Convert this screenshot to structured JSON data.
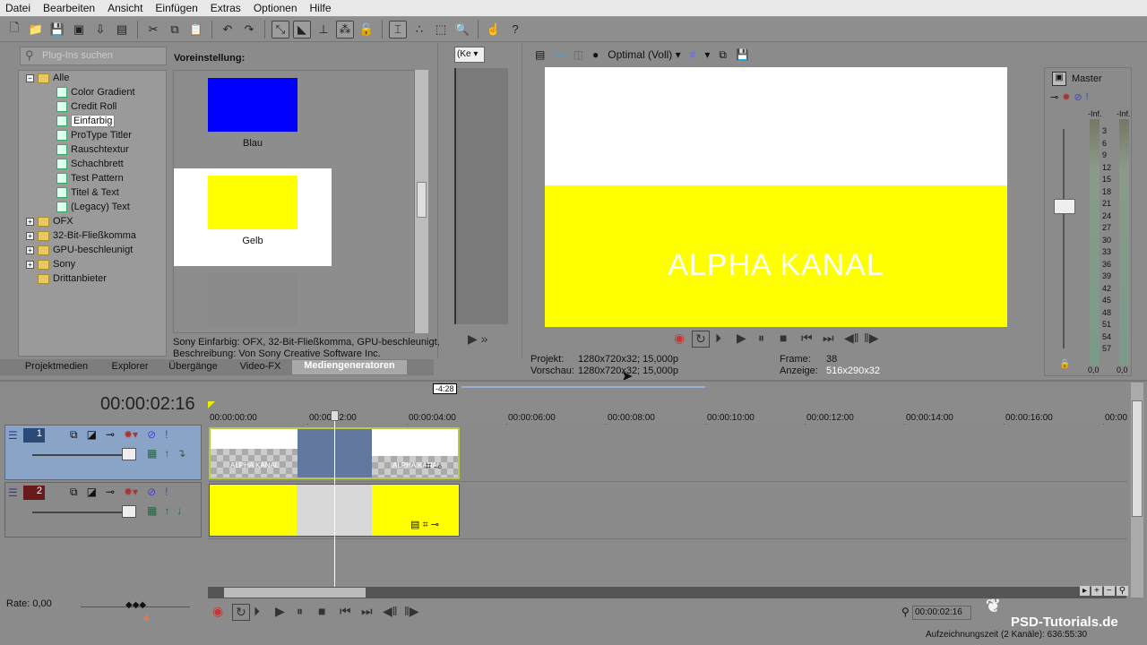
{
  "menu": [
    "Datei",
    "Bearbeiten",
    "Ansicht",
    "Einfügen",
    "Extras",
    "Optionen",
    "Hilfe"
  ],
  "plugin_search": {
    "placeholder": "Plug-Ins suchen"
  },
  "tree": {
    "root": "Alle",
    "children": [
      "Color Gradient",
      "Credit Roll",
      "Einfarbig",
      "ProType Titler",
      "Rauschtextur",
      "Schachbrett",
      "Test Pattern",
      "Titel & Text",
      "(Legacy) Text"
    ],
    "selected": "Einfarbig",
    "folders": [
      "OFX",
      "32-Bit-Fließkomma",
      "GPU-beschleunigt",
      "Sony",
      "Drittanbieter"
    ]
  },
  "presets": {
    "header": "Voreinstellung:",
    "items": [
      {
        "label": "Blau",
        "color": "#0000ff"
      },
      {
        "label": "Gelb",
        "color": "#ffff00"
      },
      {
        "label": "",
        "color": "#8a8a8a"
      }
    ]
  },
  "description": {
    "line1": "Sony Einfarbig: OFX, 32-Bit-Fließkomma, GPU-beschleunigt,",
    "line2": "Beschreibung: Von Sony Creative Software Inc."
  },
  "tabs": [
    "Projektmedien",
    "Explorer",
    "Übergänge",
    "Video-FX",
    "Mediengeneratoren"
  ],
  "trimmer": {
    "dropdown": "(Ke"
  },
  "preview": {
    "quality": "Optimal (Voll)",
    "overlay_text": "ALPHA KANAL",
    "projekt_label": "Projekt:",
    "projekt": "1280x720x32; 15,000p",
    "vorschau_label": "Vorschau:",
    "vorschau": "1280x720x32; 15,000p",
    "frame_label": "Frame:",
    "frame": "38",
    "anzeige_label": "Anzeige:",
    "anzeige": "516x290x32"
  },
  "mixer": {
    "title": "Master",
    "left_peak": "-Inf.",
    "right_peak": "-Inf.",
    "left_val": "0,0",
    "right_val": "0,0",
    "scale": [
      "3",
      "6",
      "9",
      "12",
      "15",
      "18",
      "21",
      "24",
      "27",
      "30",
      "33",
      "36",
      "39",
      "42",
      "45",
      "48",
      "51",
      "54",
      "57"
    ]
  },
  "timeline": {
    "timecode": "00:00:02:16",
    "loop_region": "-4:28",
    "ruler": [
      "00:00:00:00",
      "00:00:02:00",
      "00:00:04:00",
      "00:00:06:00",
      "00:00:08:00",
      "00:00:10:00",
      "00:00:12:00",
      "00:00:14:00",
      "00:00:16:00",
      "00:00"
    ],
    "tracks": [
      {
        "number": "1",
        "clip_text": "ALPHA KANAL"
      },
      {
        "number": "2"
      }
    ]
  },
  "rate": "Rate: 0,00",
  "cursor_time": "00:00:02:16",
  "status": "Aufzeichnungszeit (2 Kanäle): 636:55:30",
  "watermark": "PSD-Tutorials.de"
}
